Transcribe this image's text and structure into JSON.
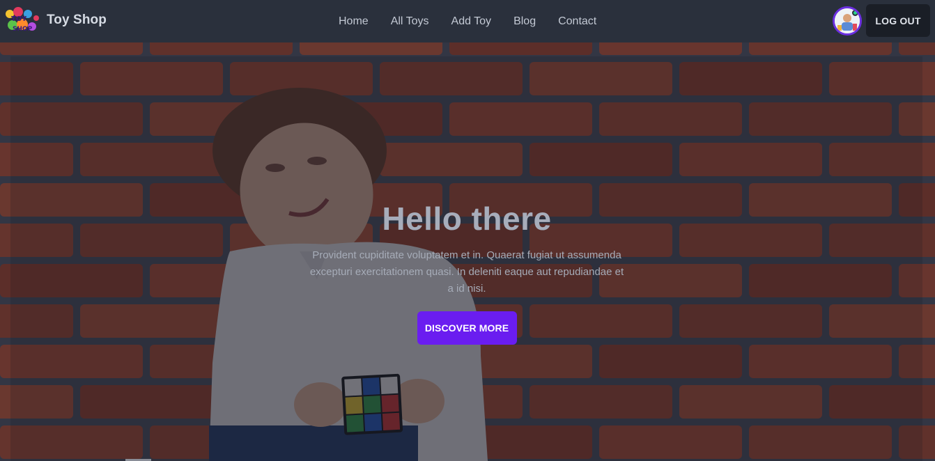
{
  "brand": {
    "name": "Toy Shop",
    "logo_text": "TOY SHOP"
  },
  "nav": {
    "items": [
      {
        "label": "Home"
      },
      {
        "label": "All Toys"
      },
      {
        "label": "Add Toy"
      },
      {
        "label": "Blog"
      },
      {
        "label": "Contact"
      }
    ],
    "logout_label": "LOG OUT"
  },
  "hero": {
    "title": "Hello there",
    "text": "Provident cupiditate voluptatem et in. Quaerat fugiat ut assumenda excepturi exercitationem quasi. In deleniti eaque aut repudiandae et a id nisi.",
    "button_label": "DISCOVER MORE"
  },
  "colors": {
    "navbar": "#2a303c",
    "accent": "#6a1df0",
    "brick": "#b0472c",
    "mortar": "#4a4f5e"
  }
}
